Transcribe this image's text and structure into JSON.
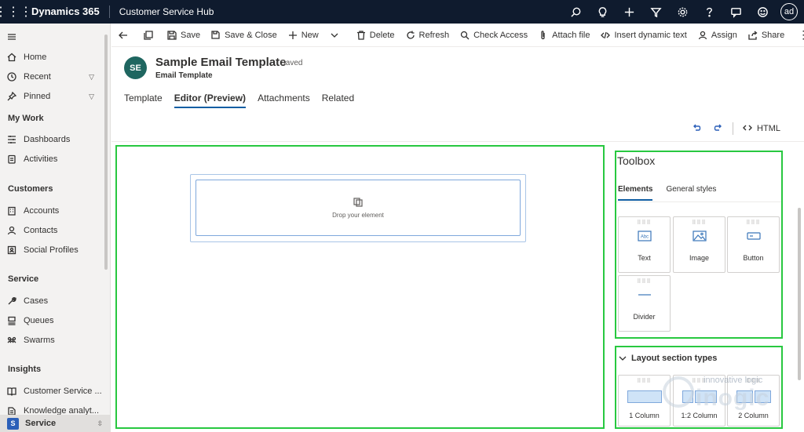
{
  "topbar": {
    "brand": "Dynamics 365",
    "app_name": "Customer Service Hub",
    "user_initials": "ad",
    "icons": [
      "search-icon",
      "lightbulb-icon",
      "plus-icon",
      "filter-icon",
      "settings-icon",
      "help-icon",
      "chat-icon",
      "smiley-icon"
    ]
  },
  "sidebar": {
    "items": [
      {
        "label": "Home",
        "icon": "home-icon"
      },
      {
        "label": "Recent",
        "icon": "clock-icon"
      },
      {
        "label": "Pinned",
        "icon": "pin-icon"
      }
    ],
    "sections": [
      {
        "title": "My Work",
        "items": [
          {
            "label": "Dashboards"
          },
          {
            "label": "Activities"
          }
        ]
      },
      {
        "title": "Customers",
        "items": [
          {
            "label": "Accounts"
          },
          {
            "label": "Contacts"
          },
          {
            "label": "Social Profiles"
          }
        ]
      },
      {
        "title": "Service",
        "items": [
          {
            "label": "Cases"
          },
          {
            "label": "Queues"
          },
          {
            "label": "Swarms"
          }
        ]
      },
      {
        "title": "Insights",
        "items": [
          {
            "label": "Customer Service ..."
          },
          {
            "label": "Knowledge analyt..."
          }
        ]
      }
    ],
    "area_badge": "S",
    "area_label": "Service"
  },
  "commands": {
    "save": "Save",
    "save_close": "Save & Close",
    "new": "New",
    "delete": "Delete",
    "refresh": "Refresh",
    "check_access": "Check Access",
    "attach_file": "Attach file",
    "insert_dynamic_text": "Insert dynamic text",
    "assign": "Assign",
    "share": "Share"
  },
  "record": {
    "initials": "SE",
    "title": "Sample Email Template",
    "status": "- Saved",
    "entity": "Email Template"
  },
  "tabs": [
    "Template",
    "Editor (Preview)",
    "Attachments",
    "Related"
  ],
  "active_tab": "Editor (Preview)",
  "editor": {
    "html_label": "HTML",
    "drop_text": "Drop your element"
  },
  "toolbox": {
    "title": "Toolbox",
    "tabs": [
      "Elements",
      "General styles"
    ],
    "elements": [
      "Text",
      "Image",
      "Button",
      "Divider"
    ],
    "layout_title": "Layout section types",
    "layouts": [
      "1 Column",
      "1:2 Column",
      "2 Column"
    ]
  },
  "watermark": {
    "line1": "innovative logic",
    "line2": "inogic"
  },
  "colors": {
    "topbar": "#0f1b2e",
    "highlight": "#28c840",
    "accent": "#115ea3",
    "avatar": "#1f6660"
  }
}
